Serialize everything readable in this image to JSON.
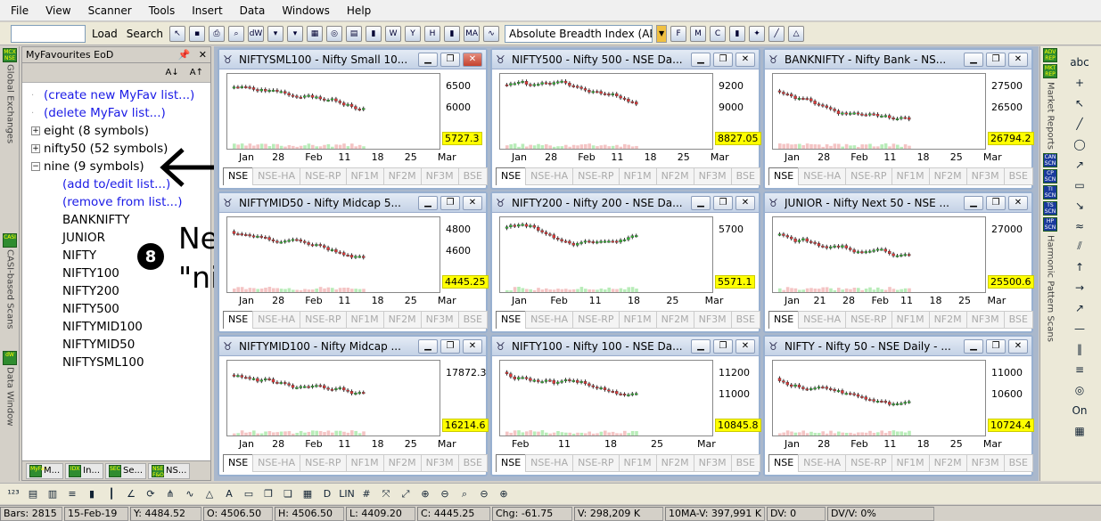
{
  "menu": [
    "File",
    "View",
    "Scanner",
    "Tools",
    "Insert",
    "Data",
    "Windows",
    "Help"
  ],
  "toolbar": {
    "load_label": "Load",
    "search_label": "Search",
    "indicator_select": "Absolute Breadth Index (ABI"
  },
  "left_tabs": [
    {
      "icon": "MCX NSE",
      "label": "Global Exchanges"
    },
    {
      "icon": "CASI",
      "label": "CASI-based Scans"
    },
    {
      "icon": "dW",
      "label": "Data Window"
    }
  ],
  "sidebar": {
    "title": "MyFavourites EoD",
    "sort_az": "A↓",
    "sort_za": "A↑",
    "tree": [
      {
        "type": "link",
        "level": 0,
        "text": "(create new MyFav list...)"
      },
      {
        "type": "link",
        "level": 0,
        "text": "(delete MyFav list...)"
      },
      {
        "type": "group",
        "level": 0,
        "ctrl": "+",
        "text": "eight (8 symbols)"
      },
      {
        "type": "group",
        "level": 0,
        "ctrl": "+",
        "text": "nifty50 (52 symbols)"
      },
      {
        "type": "group",
        "level": 0,
        "ctrl": "−",
        "text": "nine (9 symbols)"
      },
      {
        "type": "link",
        "level": 1,
        "text": "(add to/edit list...)"
      },
      {
        "type": "link",
        "level": 1,
        "text": "(remove from list...)"
      },
      {
        "type": "item",
        "level": 1,
        "text": "BANKNIFTY"
      },
      {
        "type": "item",
        "level": 1,
        "text": "JUNIOR"
      },
      {
        "type": "item",
        "level": 1,
        "text": "NIFTY"
      },
      {
        "type": "item",
        "level": 1,
        "text": "NIFTY100"
      },
      {
        "type": "item",
        "level": 1,
        "text": "NIFTY200"
      },
      {
        "type": "item",
        "level": 1,
        "text": "NIFTY500"
      },
      {
        "type": "item",
        "level": 1,
        "text": "NIFTYMID100"
      },
      {
        "type": "item",
        "level": 1,
        "text": "NIFTYMID50"
      },
      {
        "type": "item",
        "level": 1,
        "text": "NIFTYSML100"
      }
    ],
    "bottom_tabs": [
      {
        "icon": "MyFav",
        "label": "M..."
      },
      {
        "icon": "IDX",
        "label": "In..."
      },
      {
        "icon": "SEC",
        "label": "Se..."
      },
      {
        "icon": "NSE F&O",
        "label": "NS..."
      }
    ]
  },
  "annotation": {
    "badge": "8",
    "line1": "New WatchList",
    "line2": "\"nine\" created"
  },
  "chart_tabs": [
    "NSE",
    "NSE-HA",
    "NSE-RP",
    "NF1M",
    "NF2M",
    "NF3M",
    "BSE"
  ],
  "charts": [
    {
      "title": "NIFTYSML100 - Nifty Small 10...",
      "y_labels": [
        "6500",
        "6000"
      ],
      "last": "5727.3",
      "x_labels": [
        "Jan",
        "28",
        "Feb",
        "11",
        "18",
        "25",
        "Mar"
      ],
      "has_close_highlight": true
    },
    {
      "title": "NIFTY500 - Nifty 500 - NSE Da...",
      "y_labels": [
        "9200",
        "9000"
      ],
      "last": "8827.05",
      "x_labels": [
        "Jan",
        "28",
        "Feb",
        "11",
        "18",
        "25",
        "Mar"
      ],
      "has_close_highlight": false
    },
    {
      "title": "BANKNIFTY - Nifty Bank - NS...",
      "y_labels": [
        "27500",
        "26500"
      ],
      "last": "26794.2",
      "x_labels": [
        "Jan",
        "28",
        "Feb",
        "11",
        "18",
        "25",
        "Mar"
      ],
      "has_close_highlight": false
    },
    {
      "title": "NIFTYMID50 - Nifty Midcap 5...",
      "y_labels": [
        "4800",
        "4600"
      ],
      "last": "4445.25",
      "x_labels": [
        "Jan",
        "28",
        "Feb",
        "11",
        "18",
        "25",
        "Mar"
      ],
      "has_close_highlight": false
    },
    {
      "title": "NIFTY200 - Nifty 200 - NSE Da...",
      "y_labels": [
        "5700"
      ],
      "last": "5571.1",
      "x_labels": [
        "Jan",
        "Feb",
        "11",
        "18",
        "25",
        "Mar"
      ],
      "has_close_highlight": false
    },
    {
      "title": "JUNIOR - Nifty Next 50 - NSE ...",
      "y_labels": [
        "27000"
      ],
      "last": "25500.6",
      "x_labels": [
        "Jan",
        "21",
        "28",
        "Feb",
        "11",
        "18",
        "25",
        "Mar"
      ],
      "has_close_highlight": false
    },
    {
      "title": "NIFTYMID100 - Nifty Midcap ...",
      "y_labels": [
        "17872.3"
      ],
      "last": "16214.6",
      "x_labels": [
        "Jan",
        "28",
        "Feb",
        "11",
        "18",
        "25",
        "Mar"
      ],
      "has_close_highlight": false
    },
    {
      "title": "NIFTY100 - Nifty 100 - NSE Da...",
      "y_labels": [
        "11200",
        "11000"
      ],
      "last": "10845.8",
      "x_labels": [
        "Feb",
        "11",
        "18",
        "25",
        "Mar"
      ],
      "has_close_highlight": false
    },
    {
      "title": "NIFTY - Nifty 50 - NSE Daily - ...",
      "y_labels": [
        "11000",
        "10600"
      ],
      "last": "10724.4",
      "x_labels": [
        "Jan",
        "28",
        "Feb",
        "11",
        "18",
        "25",
        "Mar"
      ],
      "has_close_highlight": false
    }
  ],
  "right_tabs": [
    {
      "icon": "ADV REP",
      "label": ""
    },
    {
      "icon": "MKT REP",
      "label": "Market Reports"
    },
    {
      "icon": "CAN SCN",
      "label": ""
    },
    {
      "icon": "CP SCN",
      "label": ""
    },
    {
      "icon": "TI SCN",
      "label": ""
    },
    {
      "icon": "TS SCN",
      "label": ""
    },
    {
      "icon": "HP SCN",
      "label": "Harmonic Pattern Scans"
    }
  ],
  "status": [
    "Bars: 2815",
    "15-Feb-19",
    "Y: 4484.52",
    "O: 4506.50",
    "H: 4506.50",
    "L: 4409.20",
    "C: 4445.25",
    "Chg: -61.75",
    "V: 298,209 K",
    "10MA-V: 397,991 K",
    "DV: 0",
    "DV/V: 0%"
  ]
}
